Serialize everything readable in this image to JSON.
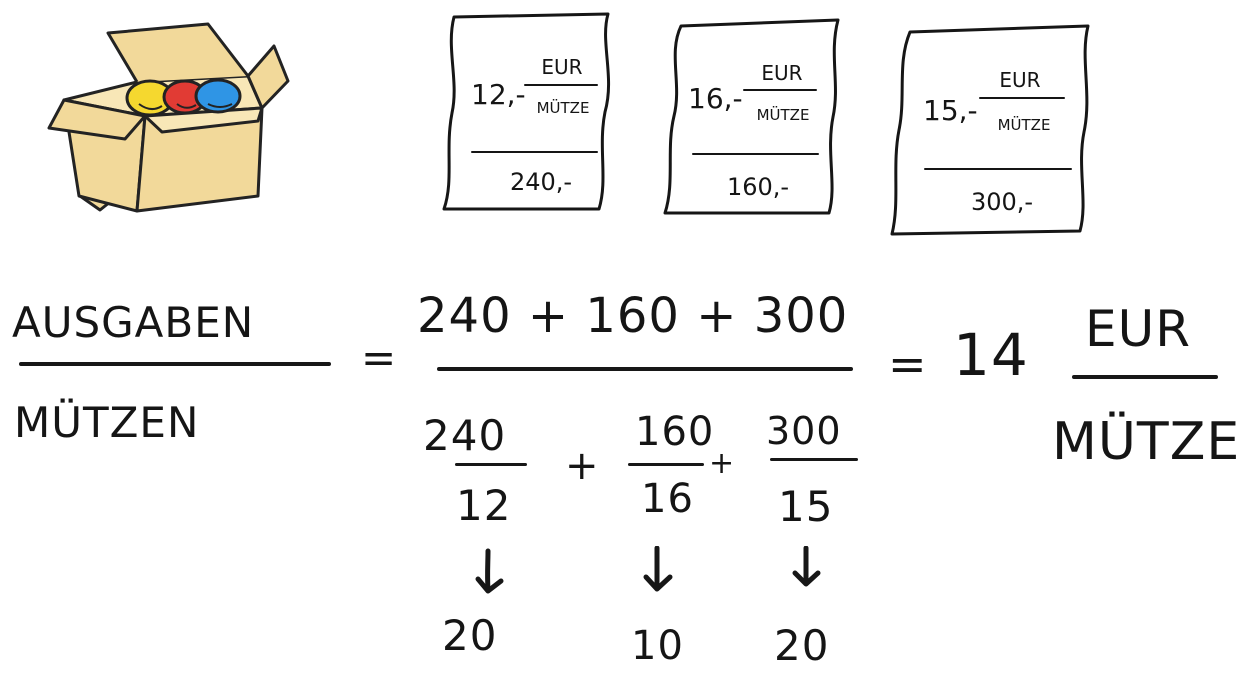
{
  "box": {
    "icon": "box-with-caps-icon",
    "colors": {
      "cardboard": "#f2d99a",
      "outline": "#232323",
      "yellow": "#f5d82f",
      "red": "#e13b34",
      "blue": "#2f95e5"
    }
  },
  "receipts": [
    {
      "price": "12,-",
      "unit_top": "EUR",
      "unit_bottom": "MÜTZE",
      "total": "240,-"
    },
    {
      "price": "16,-",
      "unit_top": "EUR",
      "unit_bottom": "MÜTZE",
      "total": "160,-"
    },
    {
      "price": "15,-",
      "unit_top": "EUR",
      "unit_bottom": "MÜTZE",
      "total": "300,-"
    }
  ],
  "formula": {
    "left_top": "AUSGABEN",
    "left_bottom": "MÜTZEN",
    "equals_1": "=",
    "numerator": "240 + 160 + 300",
    "den_terms": [
      {
        "top": "240",
        "bottom": "12",
        "result": "20"
      },
      {
        "top": "160",
        "bottom": "16",
        "result": "10"
      },
      {
        "top": "300",
        "bottom": "15",
        "result": "20"
      }
    ],
    "plus_1": "+",
    "plus_2": "+",
    "equals_2": "=",
    "result": "14",
    "unit_top": "EUR",
    "unit_bottom": "MÜTZE"
  }
}
